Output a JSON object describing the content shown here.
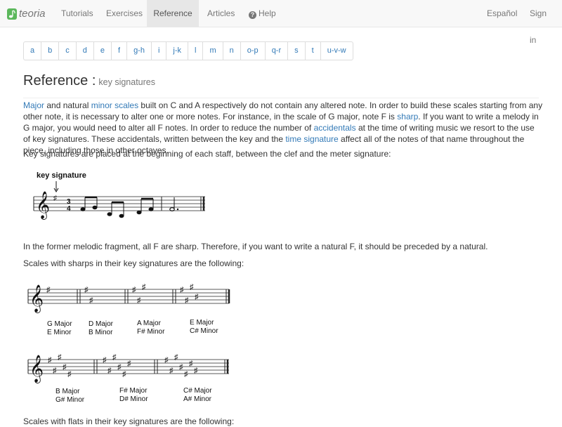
{
  "navbar": {
    "brand": "teoria",
    "tutorials": "Tutorials",
    "exercises": "Exercises",
    "reference": "Reference",
    "articles": "Articles",
    "help": "Help",
    "language": "Español",
    "signin": "Sign in"
  },
  "pager": [
    "a",
    "b",
    "c",
    "d",
    "e",
    "f",
    "g-h",
    "i",
    "j-k",
    "l",
    "m",
    "n",
    "o-p",
    "q-r",
    "s",
    "t",
    "u-v-w"
  ],
  "heading": {
    "title": "Reference :",
    "subtitle": "key signatures"
  },
  "intro": {
    "link_major": "Major",
    "t1": " and natural ",
    "link_minor_scales": "minor scales",
    "t2": " built on C and A respectively do not contain any altered note. In order to build these scales starting from any other note, it is necessary to alter one or more notes. For instance, in the scale of G major, note F is ",
    "link_sharp": "sharp",
    "t3": ". If you want to write a melody in G major, you would need to alter all F notes. In order to reduce the number of ",
    "link_accidentals": "accidentals",
    "t4": " at the time of writing music we resort to the use of key signatures. These accidentals, written between the key and the ",
    "link_time_signature": "time signature",
    "t5": " affect all of the notes of that name throughout the piece, including those in other octaves."
  },
  "para_placement": "Key signatures are placed at the beginning of each staff, between the clef and the meter signature:",
  "example": {
    "label": "key signature",
    "time_top": "3",
    "time_bottom": "4"
  },
  "para_former": "In the former melodic fragment, all F are sharp. Therefore, if you want to write a natural F, it should be preceded by a natural.",
  "para_sharps": "Scales with sharps in their key signatures are the following:",
  "sharps_row1": [
    {
      "major": "G Major",
      "minor": "E Minor"
    },
    {
      "major": "D Major",
      "minor": "B Minor"
    },
    {
      "major": "A Major",
      "minor": "F# Minor"
    },
    {
      "major": "E Major",
      "minor": "C# Minor"
    }
  ],
  "sharps_row2": [
    {
      "major": "B Major",
      "minor": "G# Minor"
    },
    {
      "major": "F# Major",
      "minor": "D# Minor"
    },
    {
      "major": "C# Major",
      "minor": "A# Minor"
    }
  ],
  "para_flats": "Scales with flats in their key signatures are the following:",
  "colors": {
    "link": "#337ab7",
    "navbar_bg": "#f8f8f8",
    "navbar_active_bg": "#e7e7e7",
    "brand_logo": "#5cb85c"
  },
  "icons": {
    "brand": "music-note-logo-icon",
    "help": "question-circle-icon"
  }
}
